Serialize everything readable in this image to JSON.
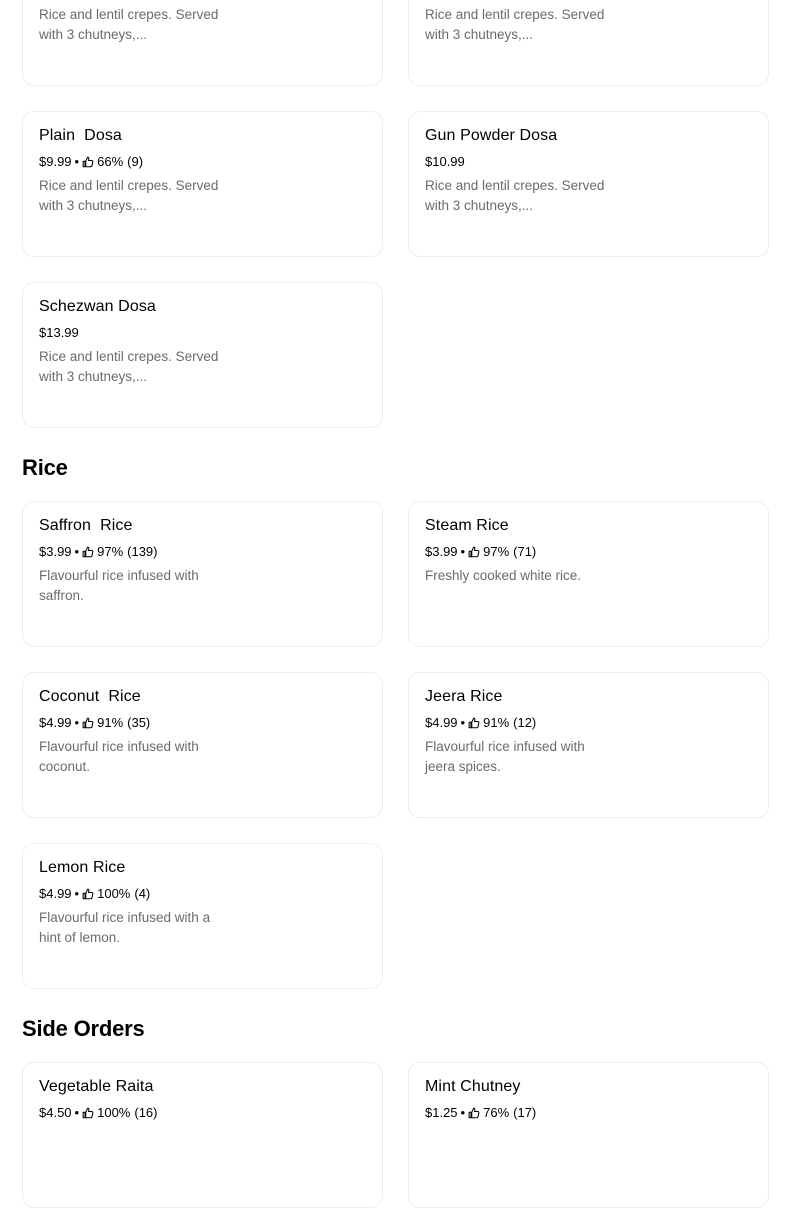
{
  "top_cards": [
    {
      "desc": "Rice and lentil crepes. Served with 3 chutneys,..."
    },
    {
      "desc": "Rice and lentil crepes. Served with 3 chutneys,..."
    }
  ],
  "dosa_items": [
    {
      "name": "Plain  Dosa",
      "price": "$9.99",
      "rating": "66%",
      "count": "(9)",
      "desc": "Rice and lentil crepes. Served with 3 chutneys,..."
    },
    {
      "name": "Gun Powder Dosa",
      "price": "$10.99",
      "desc": "Rice and lentil crepes. Served with 3 chutneys,..."
    },
    {
      "name": "Schezwan Dosa",
      "price": "$13.99",
      "desc": "Rice and lentil crepes. Served with 3 chutneys,..."
    }
  ],
  "rice": {
    "title": "Rice",
    "items": [
      {
        "name": "Saffron  Rice",
        "price": "$3.99",
        "rating": "97%",
        "count": "(139)",
        "desc": "Flavourful rice infused with saffron."
      },
      {
        "name": "Steam Rice",
        "price": "$3.99",
        "rating": "97%",
        "count": "(71)",
        "desc": "Freshly cooked white rice."
      },
      {
        "name": "Coconut  Rice",
        "price": "$4.99",
        "rating": "91%",
        "count": "(35)",
        "desc": "Flavourful rice infused with coconut."
      },
      {
        "name": "Jeera Rice",
        "price": "$4.99",
        "rating": "91%",
        "count": "(12)",
        "desc": "Flavourful rice infused with jeera spices."
      },
      {
        "name": "Lemon Rice",
        "price": "$4.99",
        "rating": "100%",
        "count": "(4)",
        "desc": "Flavourful rice infused with a hint of lemon."
      }
    ]
  },
  "side_orders": {
    "title": "Side Orders",
    "items": [
      {
        "name": "Vegetable Raita",
        "price": "$4.50",
        "rating": "100%",
        "count": "(16)"
      },
      {
        "name": "Mint Chutney",
        "price": "$1.25",
        "rating": "76%",
        "count": "(17)"
      }
    ]
  },
  "separator": "•",
  "icons": {
    "rating": "thumbs-up-icon"
  }
}
